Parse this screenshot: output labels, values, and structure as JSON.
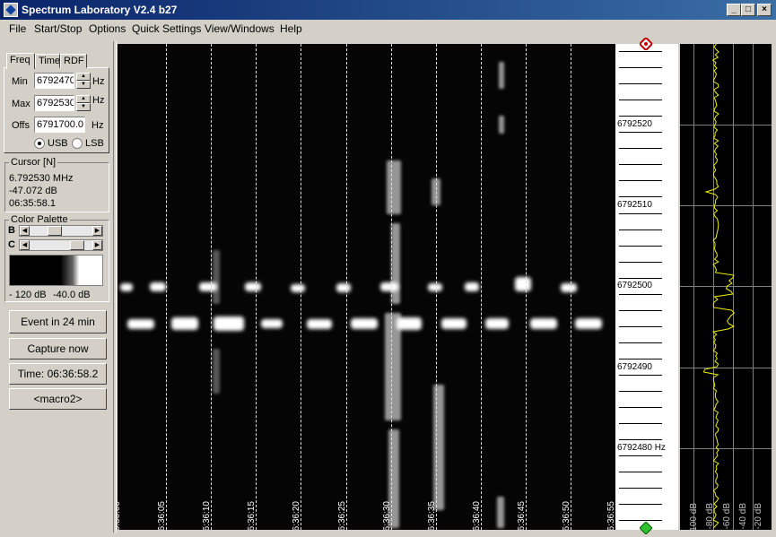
{
  "window": {
    "title": "Spectrum Laboratory V2.4 b27"
  },
  "menu": [
    {
      "label": "File"
    },
    {
      "label": "Start/Stop"
    },
    {
      "label": "Options"
    },
    {
      "label": "Quick Settings"
    },
    {
      "label": "View/Windows"
    },
    {
      "label": "Help"
    }
  ],
  "freq_panel": {
    "tabs": [
      "Freq",
      "Time",
      "RDF"
    ],
    "min_label": "Min",
    "min_value": "6792470",
    "max_label": "Max",
    "max_value": "6792530",
    "offs_label": "Offs",
    "offs_value": "6791700.0",
    "unit": "Hz",
    "usb_label": "USB",
    "lsb_label": "LSB",
    "selected_sideband": "USB"
  },
  "cursor": {
    "title": "Cursor [N]",
    "freq": "6.792530 MHz",
    "level": "-47.072 dB",
    "time": "06:35:58.1"
  },
  "palette": {
    "title": "Color Palette",
    "b_label": "B",
    "c_label": "C",
    "min_db": "- 120 dB",
    "max_db": "-40.0 dB",
    "b_level": 0.35,
    "c_level": 0.8
  },
  "buttons": {
    "event": "Event in 24 min",
    "capture": "Capture now",
    "time": "Time:  06:36:58.2",
    "macro": "<macro2>"
  },
  "waterfall": {
    "time_labels": [
      "06:36:00",
      "06:36:05",
      "06:36:10",
      "06:36:15",
      "06:36:20",
      "06:36:25",
      "06:36:30",
      "06:36:35",
      "06:36:40",
      "06:36:45",
      "06:36:50",
      "06:36:55"
    ]
  },
  "freq_scale": {
    "labels": [
      "6792520",
      "6792510",
      "6792500",
      "6792490",
      "6792480  Hz"
    ]
  },
  "spectrum": {
    "db_labels": [
      "-100 dB",
      "-80 dB",
      "-60 dB",
      "-40 dB",
      "-20 dB"
    ],
    "trace_color": "#f0f000"
  }
}
